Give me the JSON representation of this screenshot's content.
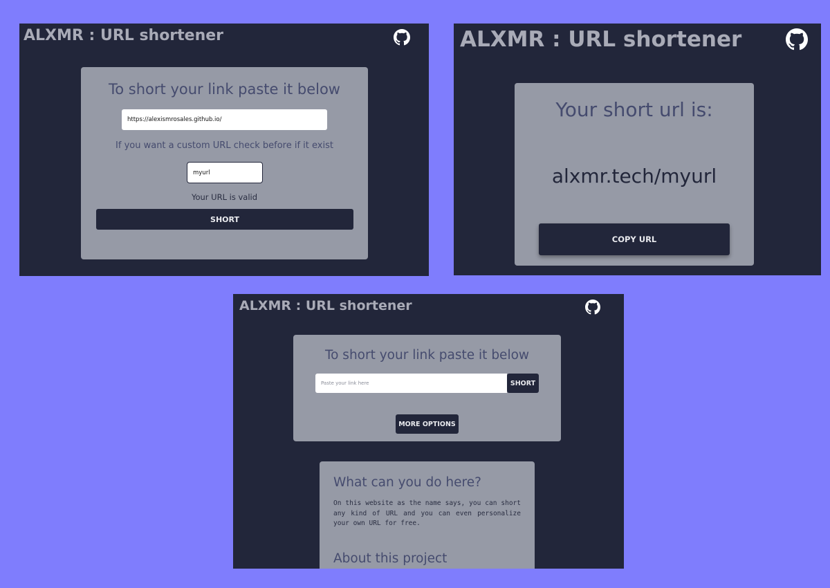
{
  "app": {
    "title": "ALXMR : URL shortener"
  },
  "icons": {
    "github": "github-icon"
  },
  "colors": {
    "background": "#7f7dfd",
    "panel": "#22263a",
    "card": "#969aa6",
    "heading": "#454b6e",
    "button": "#22263a"
  },
  "screen1": {
    "heading": "To short your link paste it below",
    "url_value": "https://alexismrosales.github.io/",
    "custom_hint": "If you want a custom URL check before if it exist",
    "custom_value": "myurl",
    "validation_message": "Your URL is valid",
    "short_button": "SHORT"
  },
  "screen2": {
    "heading": "Your short url is:",
    "short_url": "alxmr.tech/myurl",
    "copy_button": "COPY URL"
  },
  "screen3": {
    "heading": "To short your link paste it below",
    "input_placeholder": "Paste your link here",
    "short_button": "SHORT",
    "more_options_button": "MORE OPTIONS",
    "info_heading": "What can you do here?",
    "info_body": "On this website as the name says, you can short any kind of URL and you can even personalize your own URL for free.",
    "about_heading": "About this project"
  }
}
